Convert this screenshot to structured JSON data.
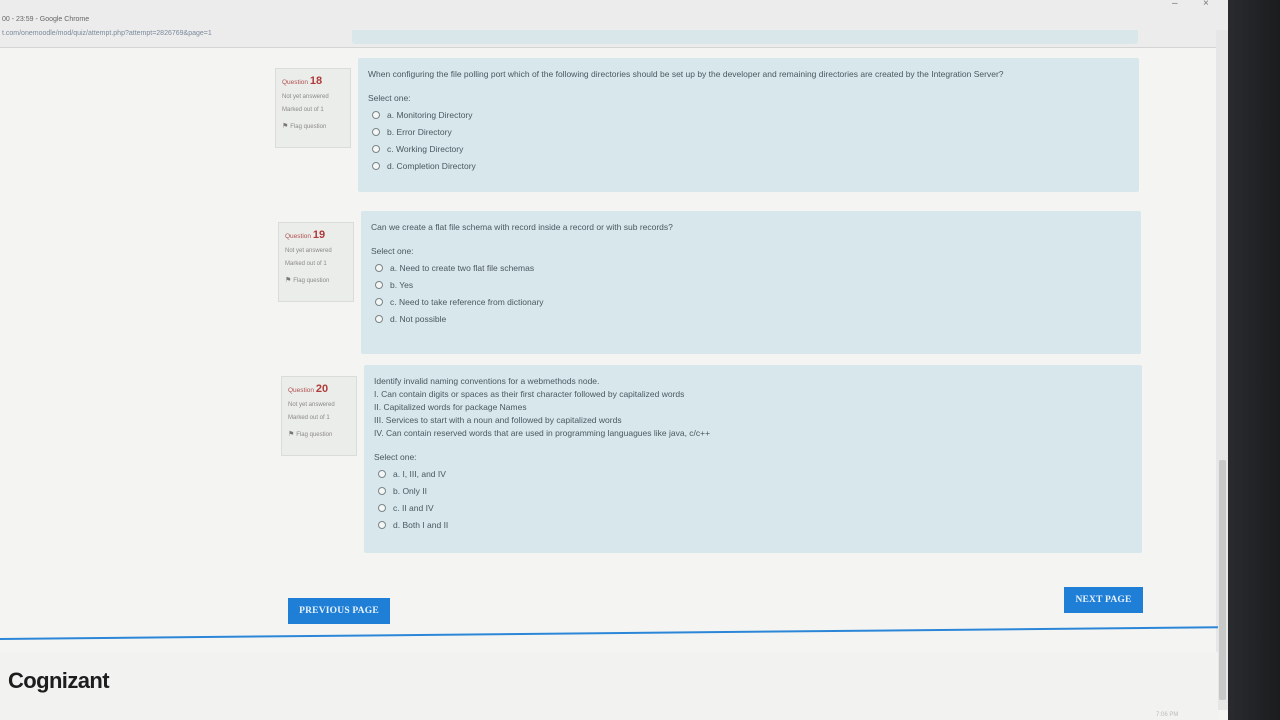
{
  "browser": {
    "window_title": "00 - 23:59 - Google Chrome",
    "url": "t.com/onemoodle/mod/quiz/attempt.php?attempt=2826769&page=1",
    "minimize": "–",
    "close": "×"
  },
  "questions": [
    {
      "label": "Question",
      "number": "18",
      "status": "Not yet answered",
      "marks": "Marked out of 1",
      "flag": "Flag question",
      "text": "When configuring the file polling port which of the following directories should be set up by the developer and remaining directories are created by the Integration Server?",
      "select": "Select one:",
      "options": [
        "a. Monitoring Directory",
        "b. Error Directory",
        "c. Working Directory",
        "d. Completion Directory"
      ]
    },
    {
      "label": "Question",
      "number": "19",
      "status": "Not yet answered",
      "marks": "Marked out of 1",
      "flag": "Flag question",
      "text": "Can we create a flat file schema with record inside a record or with sub records?",
      "select": "Select one:",
      "options": [
        "a. Need to create two flat file schemas",
        "b. Yes",
        "c. Need to take reference from dictionary",
        "d. Not possible"
      ]
    },
    {
      "label": "Question",
      "number": "20",
      "status": "Not yet answered",
      "marks": "Marked out of 1",
      "flag": "Flag question",
      "text_lines": [
        "Identify invalid naming conventions for a webmethods node.",
        "I. Can contain digits or spaces as their first character followed by capitalized words",
        "II. Capitalized words for package Names",
        "III. Services to start with a noun and followed by capitalized words",
        "IV. Can contain reserved words that are used in programming languagues like java, c/c++"
      ],
      "select": "Select one:",
      "options": [
        "a. I, III, and IV",
        "b. Only II",
        "c. II and IV",
        "d. Both I and II"
      ]
    }
  ],
  "nav": {
    "previous": "PREVIOUS PAGE",
    "next": "NEXT PAGE"
  },
  "footer": {
    "brand": "Cognizant",
    "clock": "7:06 PM"
  },
  "colors": {
    "question_bg": "#d7e7eb",
    "button": "#1f7fd6",
    "footer_line": "#2c86d8"
  }
}
